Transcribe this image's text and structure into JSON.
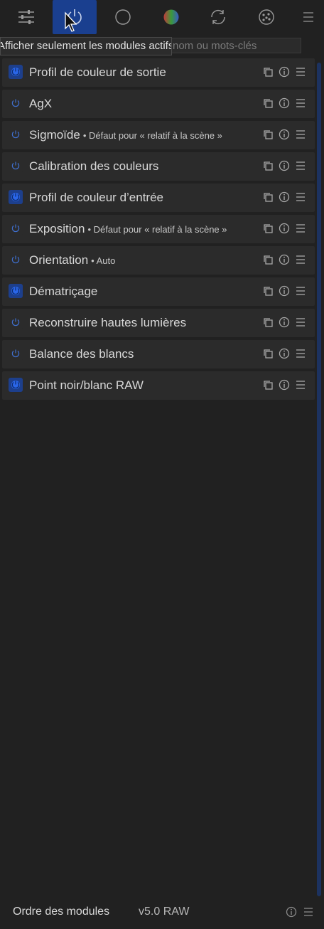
{
  "topbar": {
    "tabs": [
      {
        "icon": "sliders-icon"
      },
      {
        "icon": "power-icon",
        "active": true
      },
      {
        "icon": "circle-icon"
      },
      {
        "icon": "color-wheel-icon"
      },
      {
        "icon": "refresh-icon"
      },
      {
        "icon": "dots-circle-icon"
      }
    ],
    "menu_icon": "hamburger-icon",
    "accent": "#1a3f8f"
  },
  "tooltip": "Afficher seulement les modules actifs",
  "search": {
    "placeholder": "nom ou mots-clés"
  },
  "modules": [
    {
      "name": "Profil de couleur de sortie",
      "sub": "",
      "enabled": true
    },
    {
      "name": "AgX",
      "sub": "",
      "enabled": false
    },
    {
      "name": "Sigmoïde",
      "sub": "• Défaut pour « relatif à la scène »",
      "enabled": false
    },
    {
      "name": "Calibration des couleurs",
      "sub": "",
      "enabled": false
    },
    {
      "name": "Profil de couleur d’entrée",
      "sub": "",
      "enabled": true
    },
    {
      "name": "Exposition",
      "sub": "• Défaut pour « relatif à la scène »",
      "enabled": false
    },
    {
      "name": "Orientation",
      "sub": "• Auto",
      "enabled": false
    },
    {
      "name": "Dématriçage",
      "sub": "",
      "enabled": true
    },
    {
      "name": "Reconstruire hautes lumières",
      "sub": "",
      "enabled": false
    },
    {
      "name": "Balance des blancs",
      "sub": "",
      "enabled": false
    },
    {
      "name": "Point noir/blanc RAW",
      "sub": "",
      "enabled": true
    }
  ],
  "bottombar": {
    "label": "Ordre des modules",
    "value": "v5.0 RAW"
  }
}
